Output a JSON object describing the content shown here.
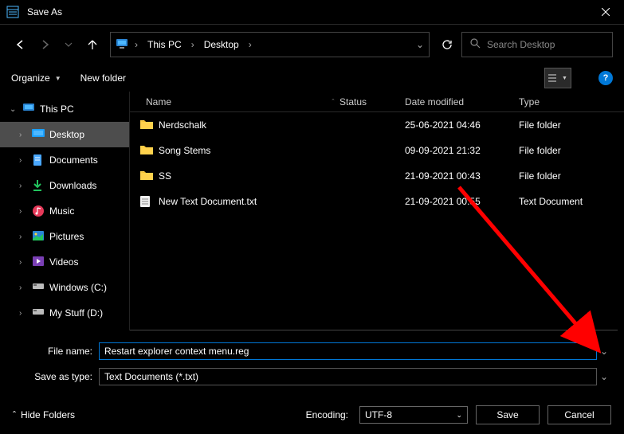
{
  "window": {
    "title": "Save As"
  },
  "breadcrumb": {
    "pc": "This PC",
    "folder": "Desktop"
  },
  "search": {
    "placeholder": "Search Desktop"
  },
  "toolbar": {
    "organize": "Organize",
    "newfolder": "New folder"
  },
  "sidebar": {
    "thispc": "This PC",
    "desktop": "Desktop",
    "documents": "Documents",
    "downloads": "Downloads",
    "music": "Music",
    "pictures": "Pictures",
    "videos": "Videos",
    "windowsc": "Windows (C:)",
    "mystuff": "My Stuff (D:)"
  },
  "columns": {
    "name": "Name",
    "status": "Status",
    "date": "Date modified",
    "type": "Type"
  },
  "files": [
    {
      "name": "Nerdschalk",
      "date": "25-06-2021 04:46",
      "type": "File folder",
      "kind": "folder"
    },
    {
      "name": "Song Stems",
      "date": "09-09-2021 21:32",
      "type": "File folder",
      "kind": "folder"
    },
    {
      "name": "SS",
      "date": "21-09-2021 00:43",
      "type": "File folder",
      "kind": "folder"
    },
    {
      "name": "New Text Document.txt",
      "date": "21-09-2021 00:55",
      "type": "Text Document",
      "kind": "text"
    }
  ],
  "form": {
    "filename_label": "File name:",
    "filename_value": "Restart explorer context menu.reg",
    "type_label": "Save as type:",
    "type_value": "Text Documents (*.txt)"
  },
  "footer": {
    "hide": "Hide Folders",
    "encoding_label": "Encoding:",
    "encoding_value": "UTF-8",
    "save": "Save",
    "cancel": "Cancel"
  }
}
